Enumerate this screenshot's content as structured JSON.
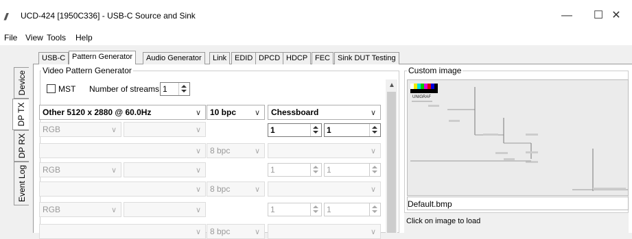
{
  "window": {
    "title": "UCD-424 [1950C336] - USB-C Source and Sink",
    "minimize": "—",
    "maximize": "☐",
    "close": "✕"
  },
  "menu": {
    "file": "File",
    "view": "View",
    "tools": "Tools",
    "help": "Help"
  },
  "side_tabs": [
    "Device",
    "DP TX",
    "DP RX",
    "Event Log"
  ],
  "tabs": [
    "USB-C",
    "Pattern Generator",
    "Audio Generator",
    "Link",
    "EDID",
    "DPCD",
    "HDCP",
    "FEC",
    "Sink DUT Testing"
  ],
  "video_group": {
    "title": "Video Pattern Generator",
    "mst_label": "MST",
    "streams_label": "Number of streams",
    "streams_value": "1"
  },
  "streams": [
    {
      "timing": "Other 5120 x 2880 @ 60.0Hz",
      "bpc": "10 bpc",
      "pattern": "Chessboard",
      "colorspace": "RGB",
      "spin_a": "1",
      "spin_b": "1",
      "enabled": true
    },
    {
      "timing": "",
      "bpc": "8 bpc",
      "pattern": "",
      "colorspace": "RGB",
      "spin_a": "1",
      "spin_b": "1",
      "enabled": false
    },
    {
      "timing": "",
      "bpc": "8 bpc",
      "pattern": "",
      "colorspace": "RGB",
      "spin_a": "1",
      "spin_b": "1",
      "enabled": false
    },
    {
      "timing": "",
      "bpc": "8 bpc",
      "pattern": "",
      "colorspace": "",
      "spin_a": "",
      "spin_b": "",
      "enabled": false
    }
  ],
  "custom_image": {
    "title": "Custom image",
    "brand": "UNIGRAF",
    "filename": "Default.bmp",
    "hint": "Click on image to load"
  }
}
